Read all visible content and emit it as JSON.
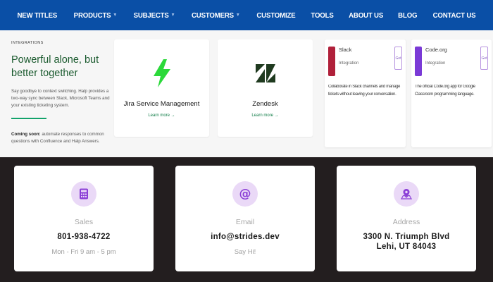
{
  "nav": {
    "items": [
      {
        "label": "NEW TITLES",
        "caret": false
      },
      {
        "label": "PRODUCTS",
        "caret": true
      },
      {
        "label": "SUBJECTS",
        "caret": true
      },
      {
        "label": "CUSTOMERS",
        "caret": true
      },
      {
        "label": "CUSTOMIZE",
        "caret": false
      },
      {
        "label": "TOOLS",
        "caret": false
      },
      {
        "label": "ABOUT US",
        "caret": false
      },
      {
        "label": "BLOG",
        "caret": false
      },
      {
        "label": "CONTACT US",
        "caret": false
      }
    ]
  },
  "integrations": {
    "eyebrow": "INTEGRATIONS",
    "headline": "Powerful alone, but better together",
    "description": "Say goodbye to context switching. Halp provides a two-way sync between Slack, Microsoft Teams and your existing ticketing system.",
    "coming_soon_label": "Coming soon:",
    "coming_soon_text": "automate responses to common questions with Confluence and Halp Answers.",
    "cards": [
      {
        "title": "Jira Service Management",
        "link": "Learn more →",
        "icon": "jira-lightning-icon",
        "color": "#2bd93a"
      },
      {
        "title": "Zendesk",
        "link": "Learn more →",
        "icon": "zendesk-icon",
        "color": "#1f3a1f"
      }
    ],
    "partial_cards": [
      {
        "name": "Slack",
        "sub": "Integration",
        "badge": "Get",
        "desc": "Collaborate in Slack channels and manage tickets without leaving your conversation.",
        "color": "#b0203a"
      },
      {
        "name": "Code.org",
        "sub": "Integration",
        "badge": "Get",
        "desc": "The official Code.org app for Google Classroom programming language.",
        "color": "#7a3ad6"
      }
    ]
  },
  "contact": {
    "cards": [
      {
        "icon": "calculator-icon",
        "label": "Sales",
        "value": "801-938-4722",
        "note": "Mon - Fri 9 am - 5 pm"
      },
      {
        "icon": "at-sign-icon",
        "label": "Email",
        "value": "info@strides.dev",
        "note": "Say Hi!"
      },
      {
        "icon": "map-pin-icon",
        "label": "Address",
        "value_line1": "3300 N. Triumph Blvd",
        "value_line2": "Lehi, UT 84043"
      }
    ],
    "icon_bg": "#ead9f7",
    "icon_color": "#8b3fd6"
  }
}
